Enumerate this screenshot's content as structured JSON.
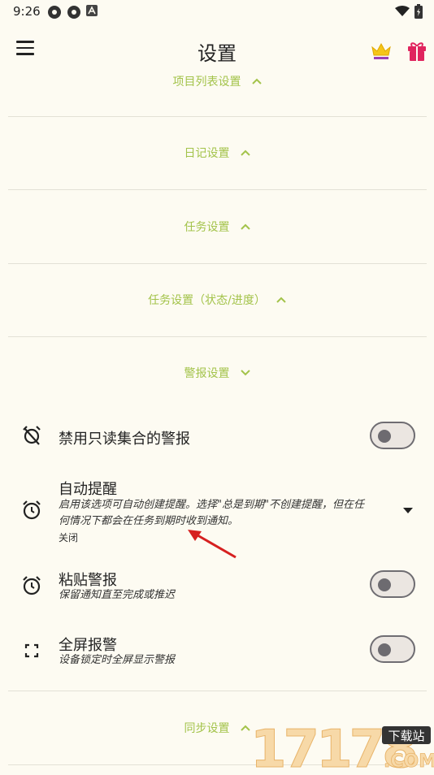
{
  "status_bar": {
    "time": "9:26"
  },
  "app_bar": {
    "title": "设置"
  },
  "sections": {
    "project_list": "项目列表设置",
    "diary": "日记设置",
    "tasks": "任务设置",
    "tasks_status": "任务设置（状态/进度）",
    "alarms": "警报设置",
    "sync": "同步设置"
  },
  "settings": {
    "disable_readonly": {
      "title": "禁用只读集合的警报",
      "enabled": false
    },
    "auto_reminder": {
      "title": "自动提醒",
      "desc_line1": "启用该选项可自动创建提醒。选择\"总是到期\"不创建提醒，但在任",
      "desc_line2": "何情况下都会在任务到期时收到通知。",
      "value": "关闭"
    },
    "sticky_alarm": {
      "title": "粘贴警报",
      "desc": "保留通知直至完成或推迟",
      "enabled": false
    },
    "fullscreen_alarm": {
      "title": "全屏报警",
      "desc": "设备锁定时全屏显示警报",
      "enabled": false
    }
  },
  "watermark": {
    "digits": "17178",
    "badge": "下载站",
    "domain": ".COM"
  },
  "colors": {
    "background": "#fdfbf2",
    "accent": "#a3c34a",
    "annotation_arrow": "#d62020"
  }
}
